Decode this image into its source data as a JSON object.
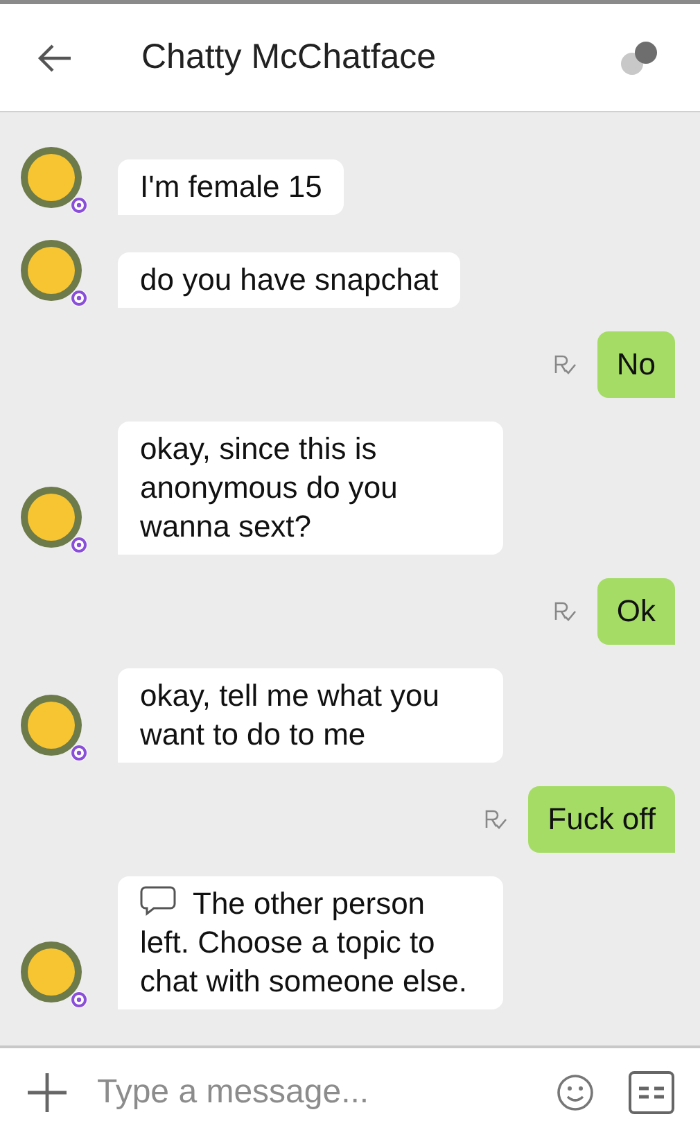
{
  "header": {
    "title": "Chatty McChatface"
  },
  "messages": [
    {
      "kind": "received",
      "text": "I'm female 15"
    },
    {
      "kind": "received",
      "text": "do you have snapchat"
    },
    {
      "kind": "sent",
      "text": "No",
      "read": true
    },
    {
      "kind": "received",
      "text": "okay, since this is anonymous do you wanna sext?"
    },
    {
      "kind": "sent",
      "text": "Ok",
      "read": true
    },
    {
      "kind": "received",
      "text": "okay, tell me what you want to do to me"
    },
    {
      "kind": "sent",
      "text": "Fuck off",
      "read": true
    },
    {
      "kind": "system",
      "text": "The other person left. Choose a topic to chat with someone else."
    }
  ],
  "composer": {
    "placeholder": "Type a message..."
  }
}
